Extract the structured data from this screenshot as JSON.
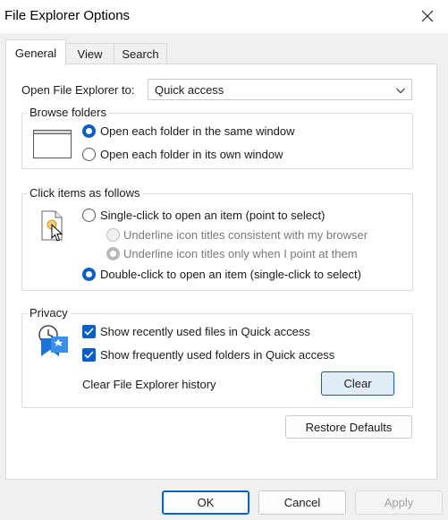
{
  "window": {
    "title": "File Explorer Options"
  },
  "tabs": [
    {
      "label": "General",
      "active": true
    },
    {
      "label": "View",
      "active": false
    },
    {
      "label": "Search",
      "active": false
    }
  ],
  "open_explorer": {
    "label": "Open File Explorer to:",
    "selected": "Quick access"
  },
  "browse_folders": {
    "title": "Browse folders",
    "options": [
      {
        "label": "Open each folder in the same window",
        "selected": true
      },
      {
        "label": "Open each folder in its own window",
        "selected": false
      }
    ]
  },
  "click_items": {
    "title": "Click items as follows",
    "single_click": {
      "label": "Single-click to open an item (point to select)",
      "selected": false
    },
    "underline_browser": {
      "label": "Underline icon titles consistent with my browser",
      "selected": false,
      "enabled": false
    },
    "underline_point": {
      "label": "Underline icon titles only when I point at them",
      "selected": true,
      "enabled": false
    },
    "double_click": {
      "label": "Double-click to open an item (single-click to select)",
      "selected": true
    }
  },
  "privacy": {
    "title": "Privacy",
    "recent_files": {
      "label": "Show recently used files in Quick access",
      "checked": true
    },
    "frequent_folders": {
      "label": "Show frequently used folders in Quick access",
      "checked": true
    },
    "clear_history_label": "Clear File Explorer history",
    "clear_button": "Clear"
  },
  "restore_defaults": "Restore Defaults",
  "footer": {
    "ok": "OK",
    "cancel": "Cancel",
    "apply": "Apply"
  },
  "colors": {
    "accent": "#0a5fc7",
    "dialog_bg": "#f0f0f0",
    "panel_bg": "#ffffff",
    "disabled_text": "#7a7a7a"
  }
}
